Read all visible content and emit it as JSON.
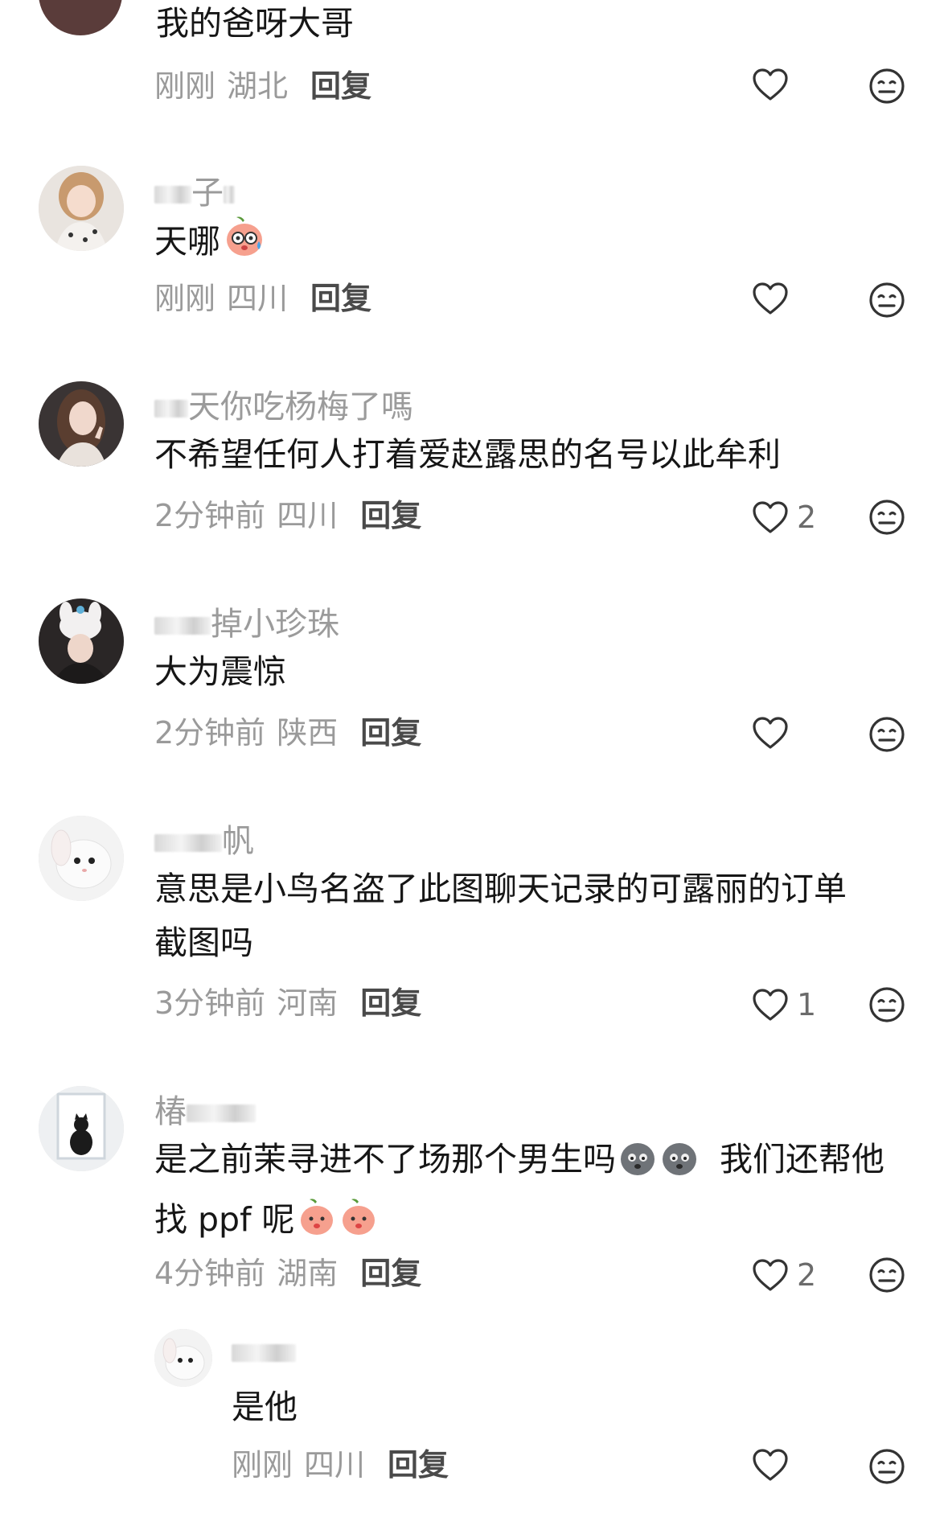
{
  "comments": [
    {
      "username": "",
      "text": "我的爸呀大哥",
      "time": "刚刚",
      "location": "湖北",
      "reply_label": "回复",
      "likes": ""
    },
    {
      "username": "子",
      "text": "天哪",
      "emojis": [
        "sweating-peach-emoji"
      ],
      "time": "刚刚",
      "location": "四川",
      "reply_label": "回复",
      "likes": ""
    },
    {
      "username": "天你吃杨梅了嗎",
      "text": "不希望任何人打着爱赵露思的名号以此牟利",
      "time": "2分钟前",
      "location": "四川",
      "reply_label": "回复",
      "likes": "2"
    },
    {
      "username": "掉小珍珠",
      "text": "大为震惊",
      "time": "2分钟前",
      "location": "陕西",
      "reply_label": "回复",
      "likes": ""
    },
    {
      "username": "帆",
      "text_line1": "意思是小鸟名盗了此图聊天记录的可露丽的订单",
      "text_line2": "截图吗",
      "time": "3分钟前",
      "location": "河南",
      "reply_label": "回复",
      "likes": "1"
    },
    {
      "username": "椿",
      "text_line1a": "是之前茉寻进不了场那个男生吗",
      "text_line1b": "我们还帮他",
      "text_line2": "找 ppf 呢",
      "emojis": [
        "gray-blob-emoji",
        "peach-emoji"
      ],
      "time": "4分钟前",
      "location": "湖南",
      "reply_label": "回复",
      "likes": "2"
    }
  ],
  "reply": {
    "username": "",
    "text": "是他",
    "time": "刚刚",
    "location": "四川",
    "reply_label": "回复",
    "likes": ""
  },
  "icons": {
    "like": "heart-outline-icon",
    "dislike": "neutral-face-icon"
  },
  "colors": {
    "meta_gray": "#9a9a9a",
    "reply_dark": "#4a4a4a",
    "text": "#161616",
    "icon_stroke": "#333333"
  }
}
